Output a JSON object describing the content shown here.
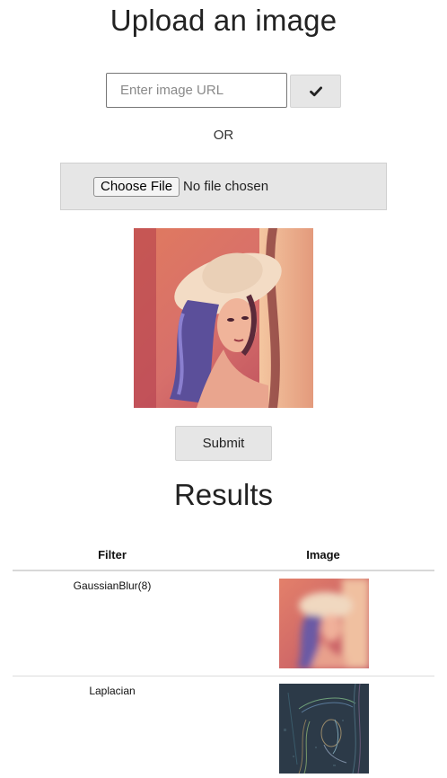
{
  "upload": {
    "title": "Upload an image",
    "url_placeholder": "Enter image URL",
    "url_submit_icon": "check-icon",
    "or_text": "OR",
    "file_button_label": "Choose File",
    "file_status": "No file chosen",
    "submit_label": "Submit"
  },
  "results": {
    "title": "Results",
    "columns": [
      "Filter",
      "Image"
    ],
    "rows": [
      {
        "filter": "GaussianBlur(8)"
      },
      {
        "filter": "Laplacian"
      }
    ]
  },
  "colors": {
    "button_bg": "#e6e6e6",
    "border": "#d2d2d2",
    "text": "#222222"
  }
}
